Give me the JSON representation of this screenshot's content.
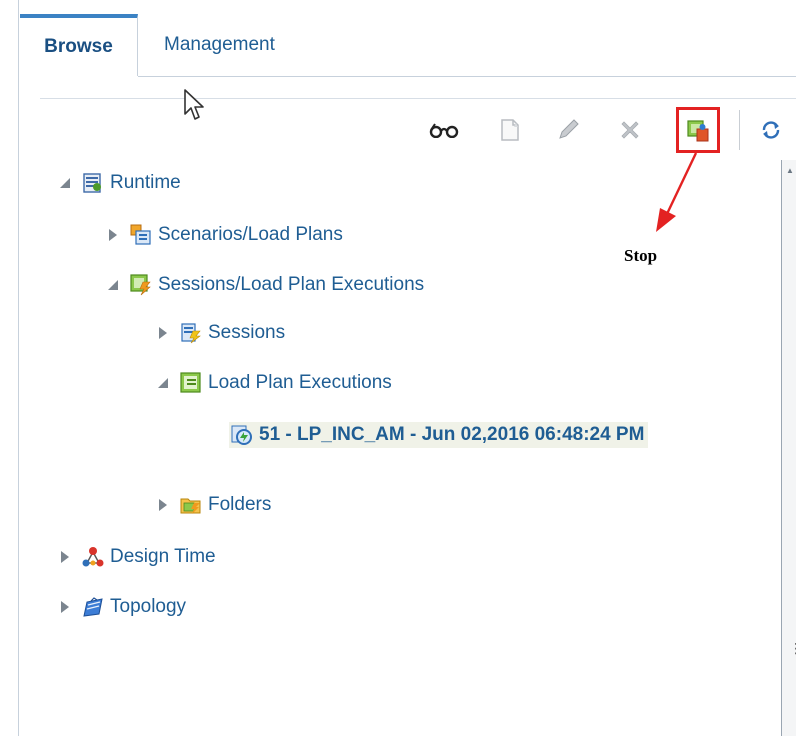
{
  "tabs": [
    {
      "label": "Browse",
      "active": true
    },
    {
      "label": "Management",
      "active": false
    }
  ],
  "toolbar": {
    "items": [
      "view-icon",
      "new-icon",
      "edit-icon",
      "delete-icon",
      "stop-icon",
      "refresh-icon"
    ],
    "highlight_color": "#e32222"
  },
  "annotation": {
    "label": "Stop",
    "arrow_color": "#e32222"
  },
  "tree": {
    "runtime": "Runtime",
    "scenarios": "Scenarios/Load Plans",
    "sessions_lpe": "Sessions/Load Plan Executions",
    "sessions": "Sessions",
    "lpe": "Load Plan Executions",
    "execution": "51 - LP_INC_AM - Jun 02,2016 06:48:24 PM",
    "folders": "Folders",
    "design_time": "Design Time",
    "topology": "Topology"
  },
  "colors": {
    "link": "#1f5d93",
    "tab_accent": "#3b82c4"
  }
}
